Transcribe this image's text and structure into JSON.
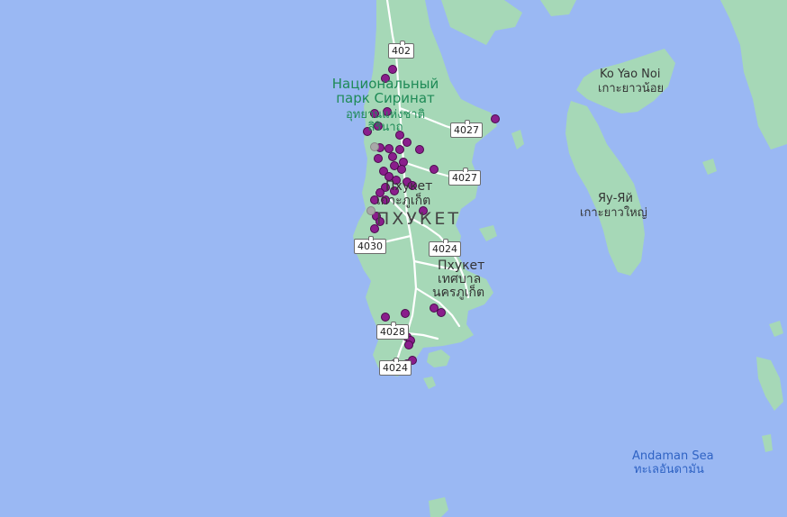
{
  "colors": {
    "sea": "#9ab8f3",
    "land": "#a6d8b7",
    "road": "#ffffff",
    "marker": "#8a1e8c",
    "marker_stroke": "#4a0b4c",
    "marker_grey": "#a8a8a8"
  },
  "labels": {
    "park_ru": "Национальный парк Сиринат",
    "park_th": "อุทยานแห่งชาติ สิรินาถ",
    "phuket_town_ru": "Пхукет",
    "phuket_town_th": "เกาะภูเก็ต",
    "province": "ПХУКЕТ",
    "city_ru": "Пхукет",
    "city_th_1": "เทศบาล",
    "city_th_2": "นครภูเก็ต",
    "yao_noi_en": "Ko Yao Noi",
    "yao_noi_th": "เกาะยาวน้อย",
    "yao_yai_ru": "Яу-Яй",
    "yao_yai_th": "เกาะยาวใหญ่",
    "sea_en": "Andaman Sea",
    "sea_th": "ทะเลอันดามัน"
  },
  "road_shields": [
    "402",
    "4027",
    "4027",
    "4030",
    "4024",
    "4028",
    "4024"
  ],
  "marker_count_note": "",
  "icons": {
    "marker": "location-dot-icon"
  }
}
